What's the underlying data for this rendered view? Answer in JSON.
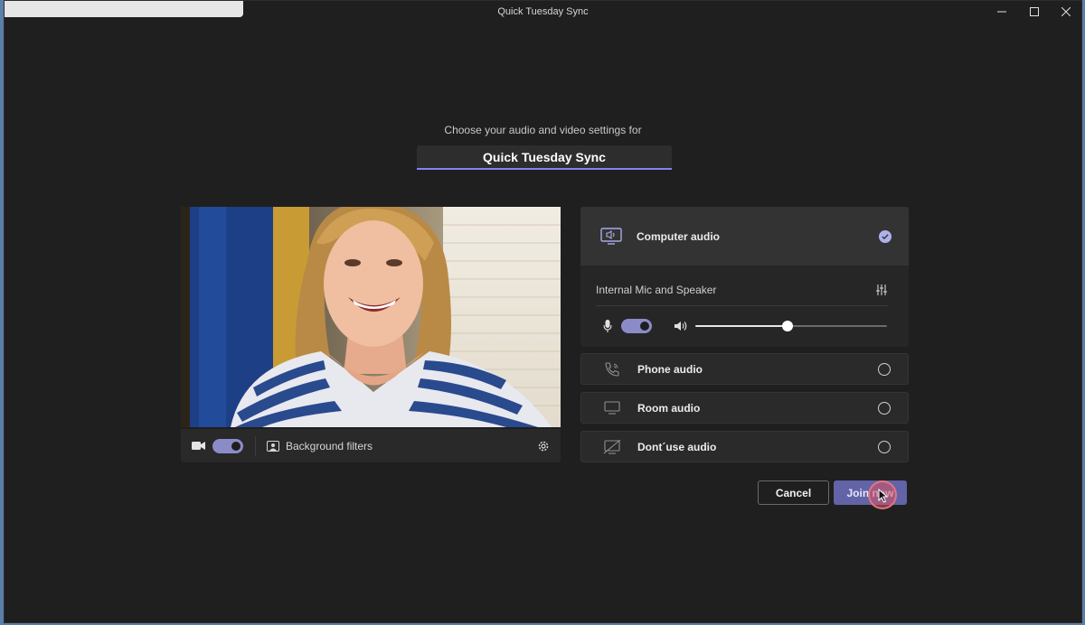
{
  "window": {
    "title": "Quick Tuesday Sync",
    "controls": {
      "minimize_icon": "minimize-icon",
      "maximize_icon": "maximize-icon",
      "close_icon": "close-icon"
    }
  },
  "prejoin": {
    "prompt": "Choose your audio and video settings for",
    "meeting_name": "Quick Tuesday Sync"
  },
  "video_bar": {
    "camera_on": true,
    "background_filters_label": "Background filters"
  },
  "audio": {
    "computer_audio": {
      "label": "Computer audio",
      "selected": true,
      "device": "Internal Mic and Speaker",
      "mic_on": true,
      "speaker_volume": 0.48
    },
    "options": [
      {
        "label": "Phone audio",
        "icon": "phone-icon",
        "selected": false
      },
      {
        "label": "Room audio",
        "icon": "monitor-icon",
        "selected": false
      },
      {
        "label": "Dont´use audio",
        "icon": "no-audio-icon",
        "selected": false
      }
    ]
  },
  "actions": {
    "cancel_label": "Cancel",
    "join_label": "Join now"
  },
  "colors": {
    "accent": "#6264a7",
    "toggle_on": "#8b8cc7",
    "background": "#1f1f1f"
  }
}
